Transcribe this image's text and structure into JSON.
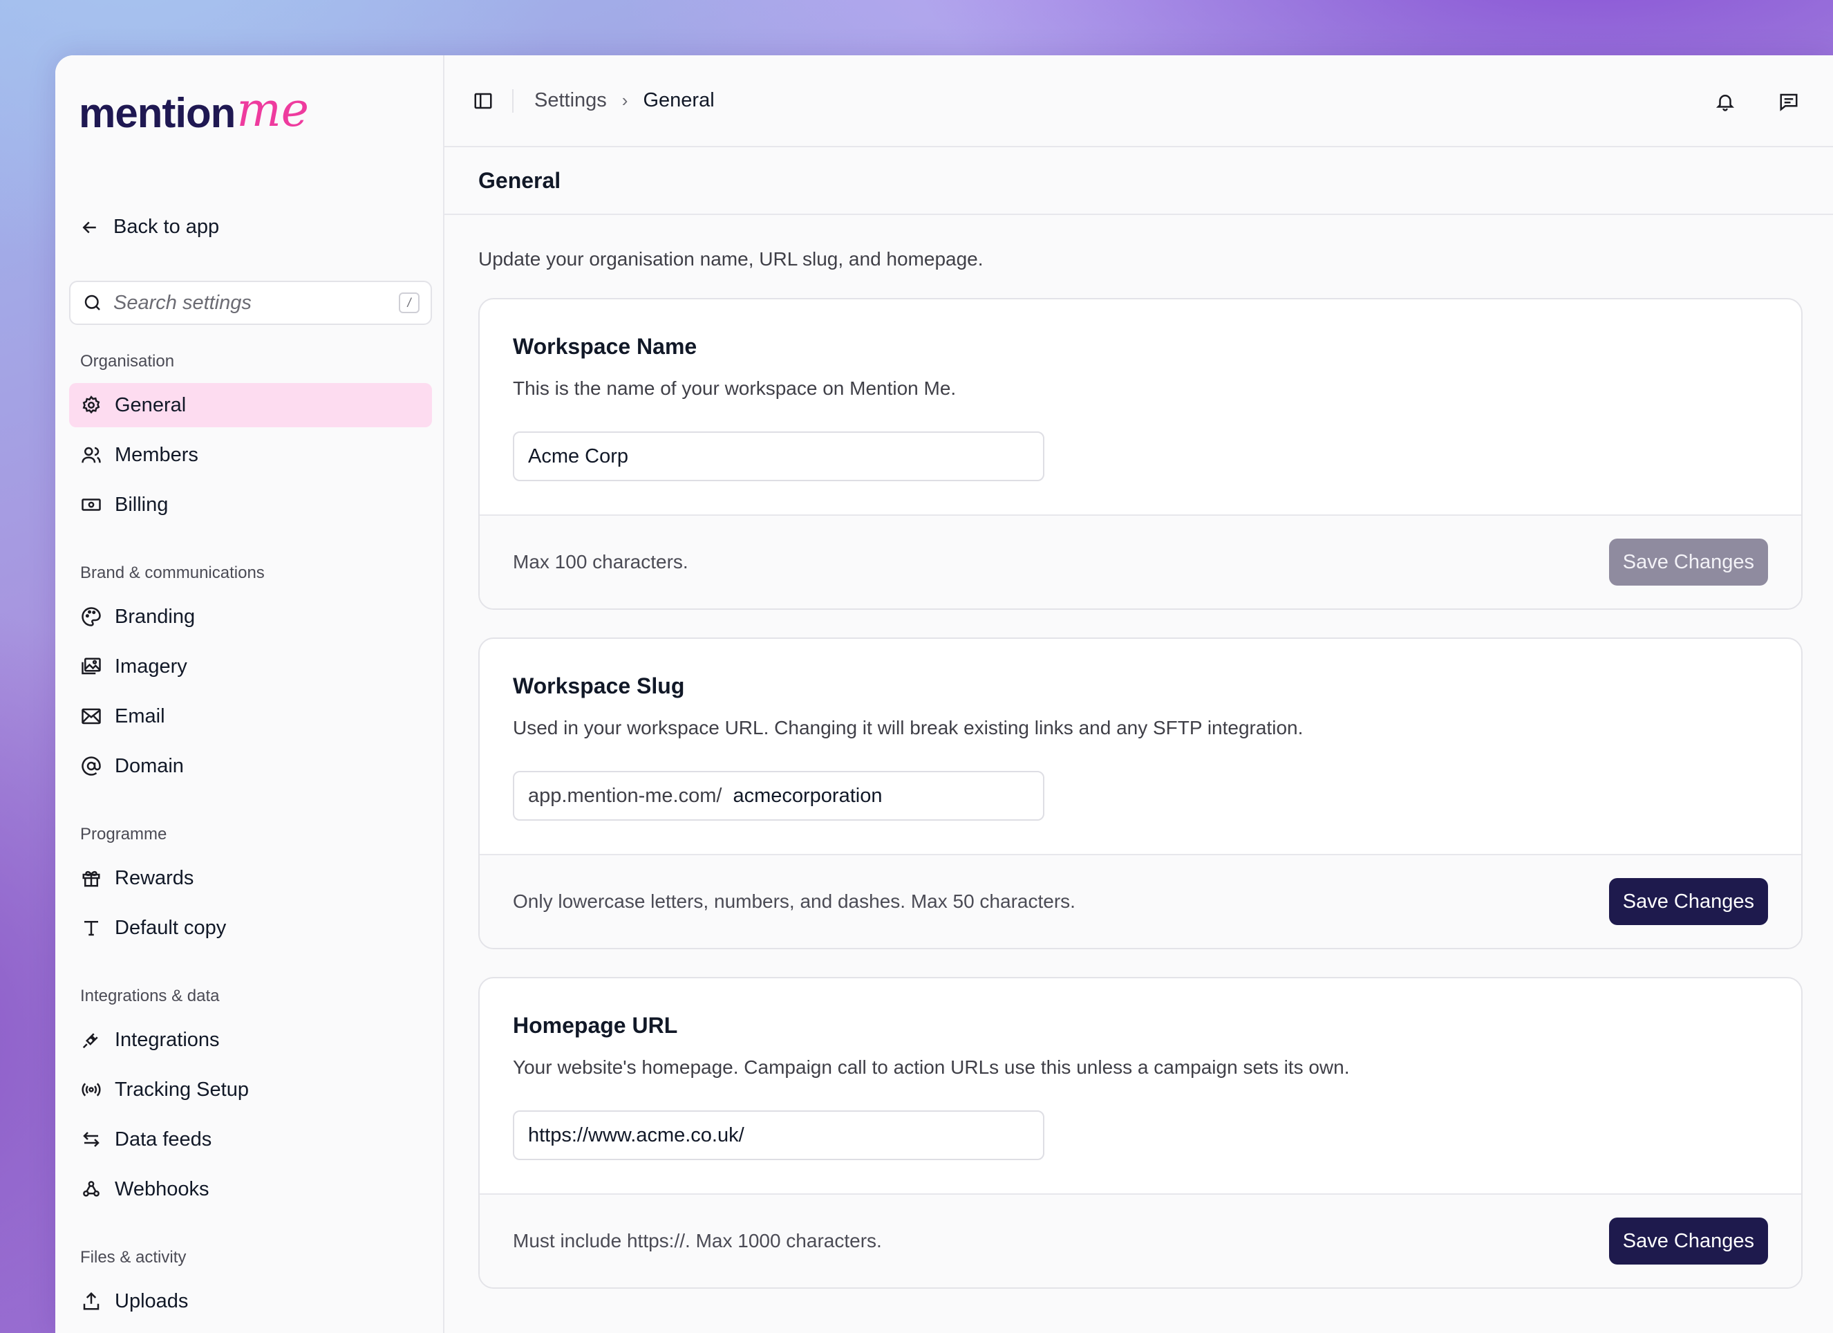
{
  "brand": {
    "logo_main": "mention",
    "logo_script": "me",
    "colors": {
      "navy": "#1e1a4d",
      "pink": "#ee3b9e",
      "active_bg": "#fddcf0"
    }
  },
  "sidebar": {
    "back_label": "Back to app",
    "search_placeholder": "Search settings",
    "search_shortcut": "/",
    "sections": [
      {
        "title": "Organisation",
        "items": [
          {
            "label": "General",
            "icon": "gear-icon",
            "active": true
          },
          {
            "label": "Members",
            "icon": "users-icon"
          },
          {
            "label": "Billing",
            "icon": "banknote-icon"
          }
        ]
      },
      {
        "title": "Brand & communications",
        "items": [
          {
            "label": "Branding",
            "icon": "palette-icon"
          },
          {
            "label": "Imagery",
            "icon": "images-icon"
          },
          {
            "label": "Email",
            "icon": "mail-icon"
          },
          {
            "label": "Domain",
            "icon": "at-sign-icon"
          }
        ]
      },
      {
        "title": "Programme",
        "items": [
          {
            "label": "Rewards",
            "icon": "gift-icon"
          },
          {
            "label": "Default copy",
            "icon": "type-icon"
          }
        ]
      },
      {
        "title": "Integrations & data",
        "items": [
          {
            "label": "Integrations",
            "icon": "plug-icon"
          },
          {
            "label": "Tracking Setup",
            "icon": "radio-icon"
          },
          {
            "label": "Data feeds",
            "icon": "arrows-exchange-icon"
          },
          {
            "label": "Webhooks",
            "icon": "webhook-icon"
          }
        ]
      },
      {
        "title": "Files & activity",
        "items": [
          {
            "label": "Uploads",
            "icon": "upload-icon"
          }
        ]
      }
    ]
  },
  "topbar": {
    "breadcrumb": [
      "Settings",
      "General"
    ]
  },
  "page": {
    "title": "General",
    "description": "Update your organisation name, URL slug, and homepage.",
    "cards": [
      {
        "title": "Workspace Name",
        "description": "This is the name of your workspace on Mention Me.",
        "value": "Acme Corp",
        "hint": "Max 100 characters.",
        "button": "Save Changes"
      },
      {
        "title": "Workspace Slug",
        "description": "Used in your workspace URL. Changing it will break existing links and any SFTP integration.",
        "prefix": "app.mention-me.com/",
        "value": "acmecorporation",
        "hint": "Only lowercase letters, numbers, and dashes. Max 50 characters.",
        "button": "Save Changes"
      },
      {
        "title": "Homepage URL",
        "description": "Your website's homepage. Campaign call to action URLs use this unless a campaign sets its own.",
        "value": "https://www.acme.co.uk/",
        "hint": "Must include https://. Max 1000 characters.",
        "button": "Save Changes"
      }
    ]
  }
}
